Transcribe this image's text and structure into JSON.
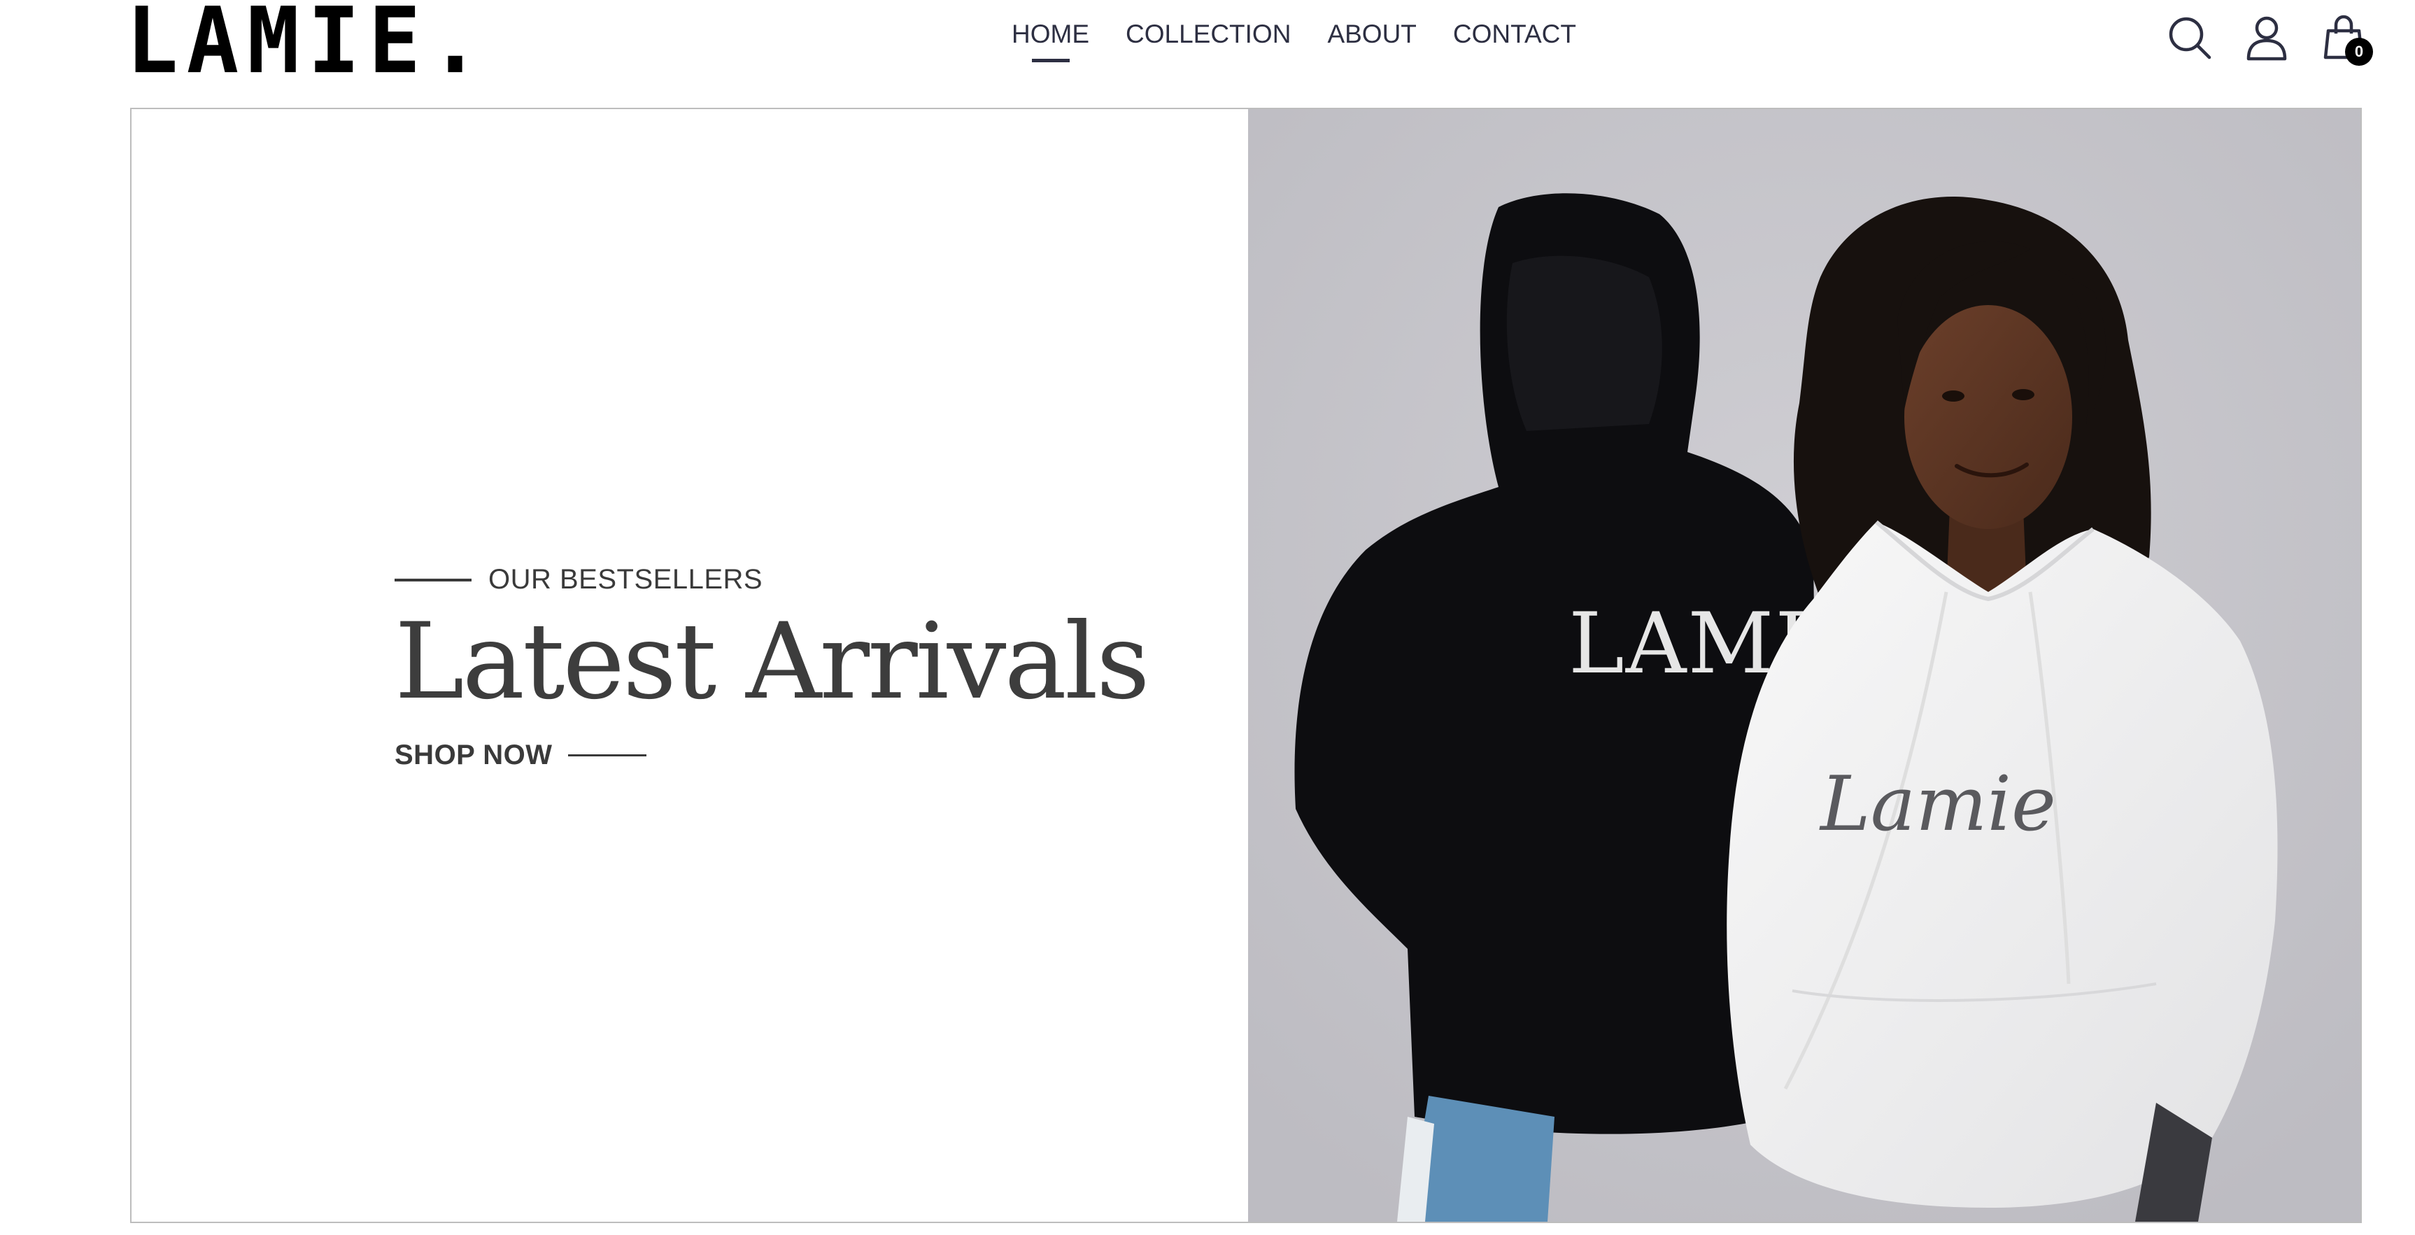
{
  "brand": {
    "logo": "LAMIE."
  },
  "nav": {
    "items": [
      {
        "label": "HOME",
        "active": true
      },
      {
        "label": "COLLECTION",
        "active": false
      },
      {
        "label": "ABOUT",
        "active": false
      },
      {
        "label": "CONTACT",
        "active": false
      }
    ]
  },
  "header_icons": {
    "search": "search-icon",
    "account": "account-icon",
    "cart": "shopping-bag-icon",
    "cart_count": "0"
  },
  "hero": {
    "eyebrow": "OUR BESTSELLERS",
    "title": "Latest Arrivals",
    "cta": "SHOP NOW",
    "photo": {
      "back_hoodie_print": "LAMIE",
      "front_hoodie_print": "Lamie"
    }
  },
  "colors": {
    "text": "#2d2f42",
    "hero_text": "#3d3d3d",
    "photo_background": "#c4c3c9",
    "black_hoodie": "#0c0c0e",
    "white_hoodie": "#f2f2f2",
    "badge": "#000000"
  }
}
